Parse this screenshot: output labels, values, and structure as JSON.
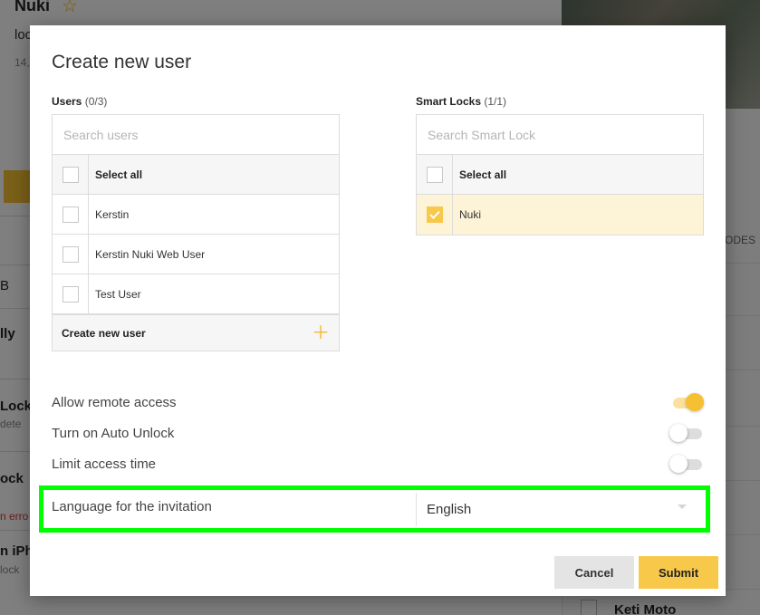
{
  "background": {
    "title": "Nuki",
    "subtitle_fragment": "loc",
    "meta_fragment": "14,",
    "codes_fragment": "ODES",
    "row_labels": [
      "B",
      "lly",
      "Lock",
      "dete",
      "ock",
      "n erro",
      "n iPhe",
      "lock"
    ],
    "list_item": "Keti Moto"
  },
  "modal": {
    "title": "Create new user",
    "users": {
      "label": "Users",
      "count": "(0/3)",
      "search_placeholder": "Search users",
      "select_all": "Select all",
      "items": [
        {
          "name": "Kerstin",
          "checked": false
        },
        {
          "name": "Kerstin Nuki Web User",
          "checked": false
        },
        {
          "name": "Test User",
          "checked": false
        }
      ],
      "create_label": "Create new user"
    },
    "locks": {
      "label": "Smart Locks",
      "count": "(1/1)",
      "search_placeholder": "Search Smart Lock",
      "select_all": "Select all",
      "items": [
        {
          "name": "Nuki",
          "checked": true
        }
      ]
    },
    "options": {
      "remote_access": {
        "label": "Allow remote access",
        "enabled": true
      },
      "auto_unlock": {
        "label": "Turn on Auto Unlock",
        "enabled": false
      },
      "limit_time": {
        "label": "Limit access time",
        "enabled": false
      }
    },
    "language": {
      "label": "Language for the invitation",
      "value": "English"
    },
    "buttons": {
      "cancel": "Cancel",
      "submit": "Submit"
    }
  },
  "colors": {
    "accent": "#f7c84a",
    "highlight": "#00ff00",
    "selected_row": "#fdf3d6"
  }
}
